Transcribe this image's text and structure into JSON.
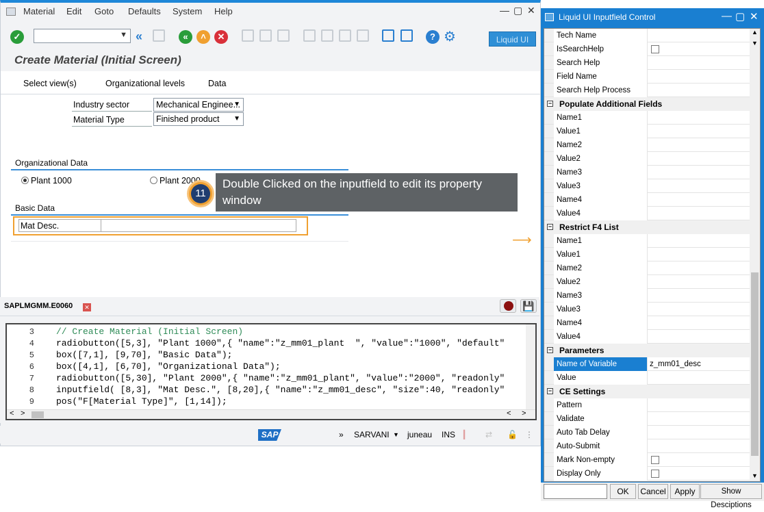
{
  "menubar": {
    "items": [
      "Material",
      "Edit",
      "Goto",
      "Defaults",
      "System",
      "Help"
    ]
  },
  "toolbar": {
    "liquid_ui_label": "Liquid UI",
    "command_field": ""
  },
  "screen": {
    "title": "Create Material (Initial Screen)",
    "app_toolbar": [
      "Select view(s)",
      "Organizational levels",
      "Data"
    ],
    "industry_sector_label": "Industry sector",
    "industry_sector_value": "Mechanical Enginee...",
    "material_type_label": "Material Type",
    "material_type_value": "Finished product",
    "org_group_title": "Organizational Data",
    "plant1_label": "Plant 1000",
    "plant2_label": "Plant 2000",
    "basic_group_title": "Basic Data",
    "mat_desc_label": "Mat Desc."
  },
  "callout": {
    "step": "11",
    "text": "Double Clicked on the inputfield to edit its property window"
  },
  "editor": {
    "tab_name": "SAPLMGMM.E0060",
    "lines": [
      {
        "n": "3",
        "text": "// Create Material (Initial Screen)"
      },
      {
        "n": "4",
        "text": "radiobutton([5,3], \"Plant 1000\",{ \"name\":\"z_mm01_plant  \", \"value\":\"1000\", \"default\""
      },
      {
        "n": "5",
        "text": "box([7,1], [9,70], \"Basic Data\");"
      },
      {
        "n": "6",
        "text": "box([4,1], [6,70], \"Organizational Data\");"
      },
      {
        "n": "7",
        "text": "radiobutton([5,30], \"Plant 2000\",{ \"name\":\"z_mm01_plant\", \"value\":\"2000\", \"readonly\""
      },
      {
        "n": "8",
        "text": "inputfield( [8,3], \"Mat Desc.\", [8,20],{ \"name\":\"z_mm01_desc\", \"size\":40, \"readonly\""
      },
      {
        "n": "9",
        "text": "pos(\"F[Material Type]\", [1,14]);"
      }
    ]
  },
  "status": {
    "user": "SARVANI",
    "server": "juneau",
    "mode": "INS"
  },
  "dialog": {
    "title": "Liquid UI Inputfield Control",
    "rows": [
      {
        "type": "row",
        "key": "Tech Name",
        "value": ""
      },
      {
        "type": "check",
        "key": "IsSearchHelp"
      },
      {
        "type": "row",
        "key": "Search Help",
        "value": ""
      },
      {
        "type": "row",
        "key": "Field Name",
        "value": ""
      },
      {
        "type": "row",
        "key": "Search Help Process",
        "value": ""
      },
      {
        "type": "section",
        "key": "Populate Additional Fields"
      },
      {
        "type": "row",
        "key": "Name1",
        "value": ""
      },
      {
        "type": "row",
        "key": "Value1",
        "value": ""
      },
      {
        "type": "row",
        "key": "Name2",
        "value": ""
      },
      {
        "type": "row",
        "key": "Value2",
        "value": ""
      },
      {
        "type": "row",
        "key": "Name3",
        "value": ""
      },
      {
        "type": "row",
        "key": "Value3",
        "value": ""
      },
      {
        "type": "row",
        "key": "Name4",
        "value": ""
      },
      {
        "type": "row",
        "key": "Value4",
        "value": ""
      },
      {
        "type": "section",
        "key": "Restrict F4 List"
      },
      {
        "type": "row",
        "key": "Name1",
        "value": ""
      },
      {
        "type": "row",
        "key": "Value1",
        "value": ""
      },
      {
        "type": "row",
        "key": "Name2",
        "value": ""
      },
      {
        "type": "row",
        "key": "Value2",
        "value": ""
      },
      {
        "type": "row",
        "key": "Name3",
        "value": ""
      },
      {
        "type": "row",
        "key": "Value3",
        "value": ""
      },
      {
        "type": "row",
        "key": "Name4",
        "value": ""
      },
      {
        "type": "row",
        "key": "Value4",
        "value": ""
      },
      {
        "type": "section",
        "key": "Parameters"
      },
      {
        "type": "row",
        "key": "Name of Variable",
        "value": "z_mm01_desc",
        "selected": true
      },
      {
        "type": "row",
        "key": "Value",
        "value": ""
      },
      {
        "type": "section",
        "key": "CE Settings"
      },
      {
        "type": "row",
        "key": "Pattern",
        "value": ""
      },
      {
        "type": "row",
        "key": "Validate",
        "value": ""
      },
      {
        "type": "row",
        "key": "Auto Tab Delay",
        "value": ""
      },
      {
        "type": "row",
        "key": "Auto-Submit",
        "value": ""
      },
      {
        "type": "check",
        "key": "Mark Non-empty"
      },
      {
        "type": "check",
        "key": "Display Only"
      }
    ],
    "buttons": {
      "ok": "OK",
      "cancel": "Cancel",
      "apply": "Apply",
      "show_descriptions": "Show Desciptions"
    }
  },
  "colors": {
    "accent_blue": "#1a7fd1",
    "highlight_orange": "#f0a030",
    "callout_bg": "#5e6265"
  }
}
